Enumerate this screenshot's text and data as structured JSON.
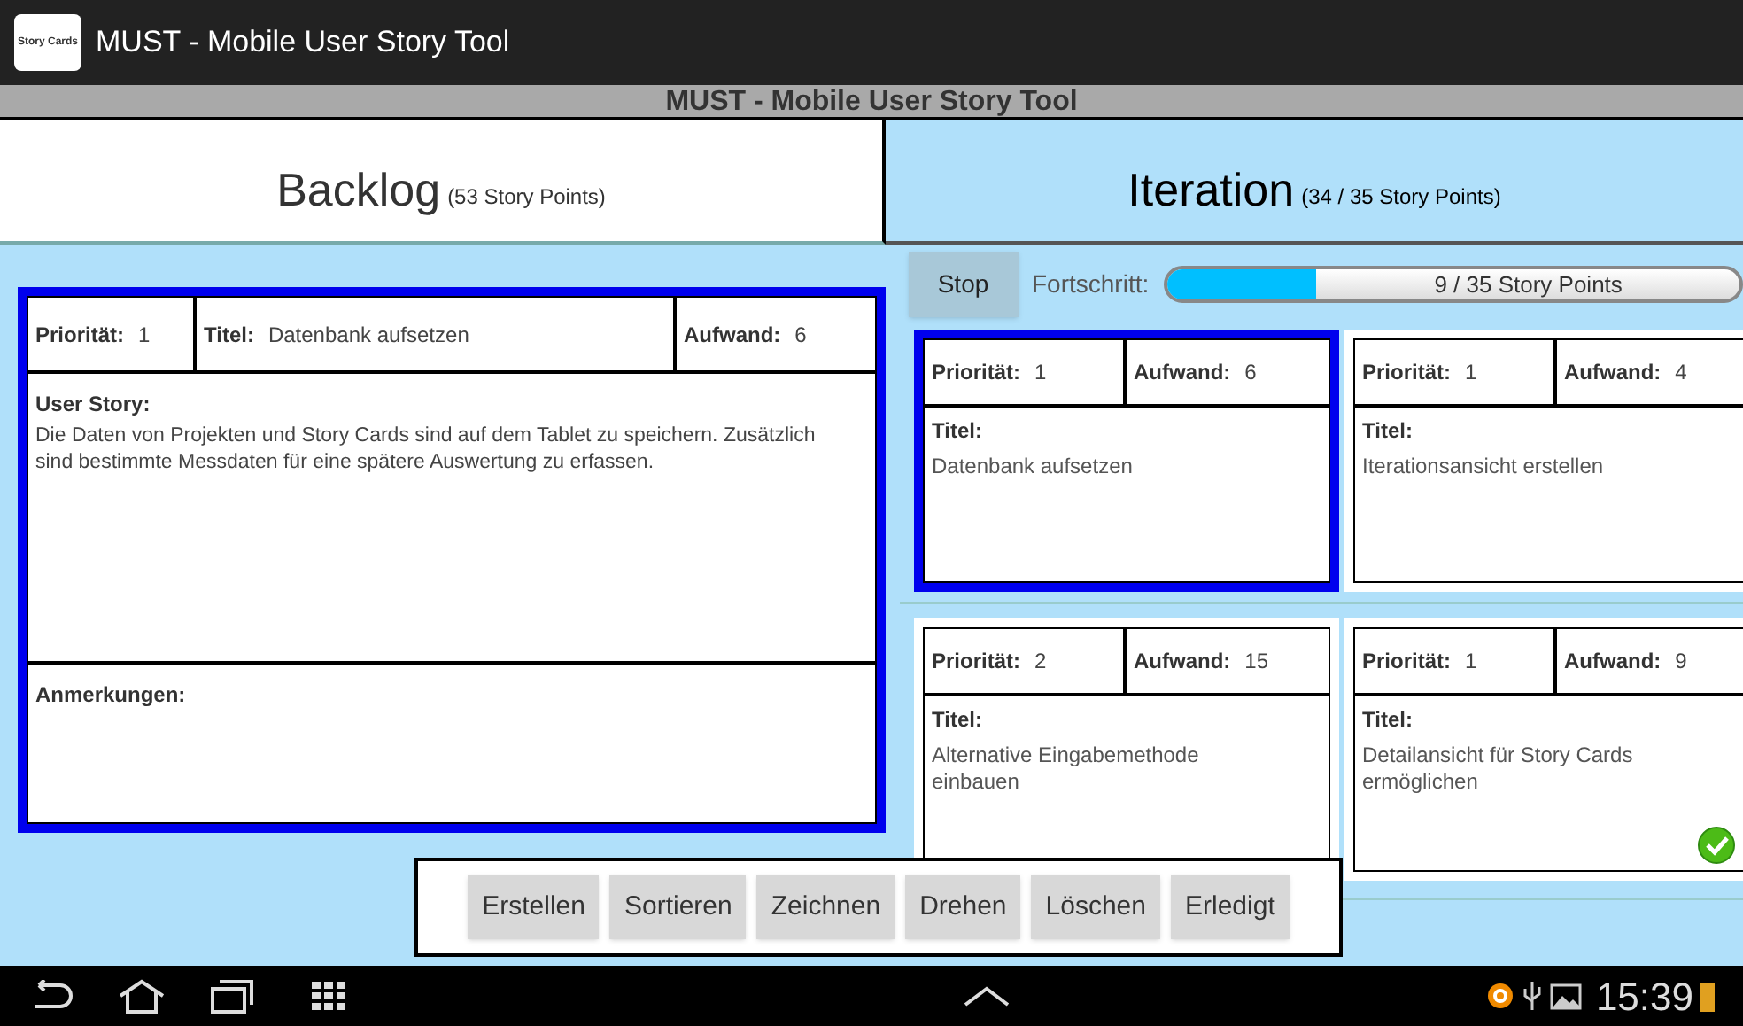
{
  "action_bar": {
    "logo_text": "Story Cards",
    "title": "MUST - Mobile User Story Tool"
  },
  "title_bar": "MUST - Mobile User Story Tool",
  "backlog": {
    "title": "Backlog",
    "points": "(53 Story Points)",
    "card": {
      "priority_label": "Priorität:",
      "priority": "1",
      "title_label": "Titel:",
      "title": "Datenbank aufsetzen",
      "effort_label": "Aufwand:",
      "effort": "6",
      "story_label": "User Story:",
      "story": "Die Daten von Projekten und Story Cards sind auf dem Tablet zu speichern. Zusätzlich sind bestimmte Messdaten für eine spätere Auswertung zu erfassen.",
      "notes_label": "Anmerkungen:",
      "selected": true
    }
  },
  "iteration": {
    "title": "Iteration",
    "points": "(34 / 35 Story Points)",
    "stop_button": "Stop",
    "progress_label": "Fortschritt:",
    "progress_text": "9 / 35 Story Points",
    "level": 0.26,
    "cards": [
      {
        "priority_label": "Priorität:",
        "priority": "1",
        "effort_label": "Aufwand:",
        "effort": "6",
        "title_label": "Titel:",
        "title": "Datenbank aufsetzen",
        "selected": true,
        "done": false
      },
      {
        "priority_label": "Priorität:",
        "priority": "1",
        "effort_label": "Aufwand:",
        "effort": "4",
        "title_label": "Titel:",
        "title": "Iterationsansicht erstellen",
        "selected": false,
        "done": false
      },
      {
        "priority_label": "Priorität:",
        "priority": "2",
        "effort_label": "Aufwand:",
        "effort": "15",
        "title_label": "Titel:",
        "title": "Alternative Eingabemethode einbauen",
        "selected": false,
        "done": false
      },
      {
        "priority_label": "Priorität:",
        "priority": "1",
        "effort_label": "Aufwand:",
        "effort": "9",
        "title_label": "Titel:",
        "title": "Detailansicht für Story Cards ermöglichen",
        "selected": false,
        "done": true
      }
    ]
  },
  "toolbar": [
    "Erstellen",
    "Sortieren",
    "Zeichnen",
    "Drehen",
    "Löschen",
    "Erledigt"
  ],
  "status_bar": {
    "time": "15:39"
  }
}
